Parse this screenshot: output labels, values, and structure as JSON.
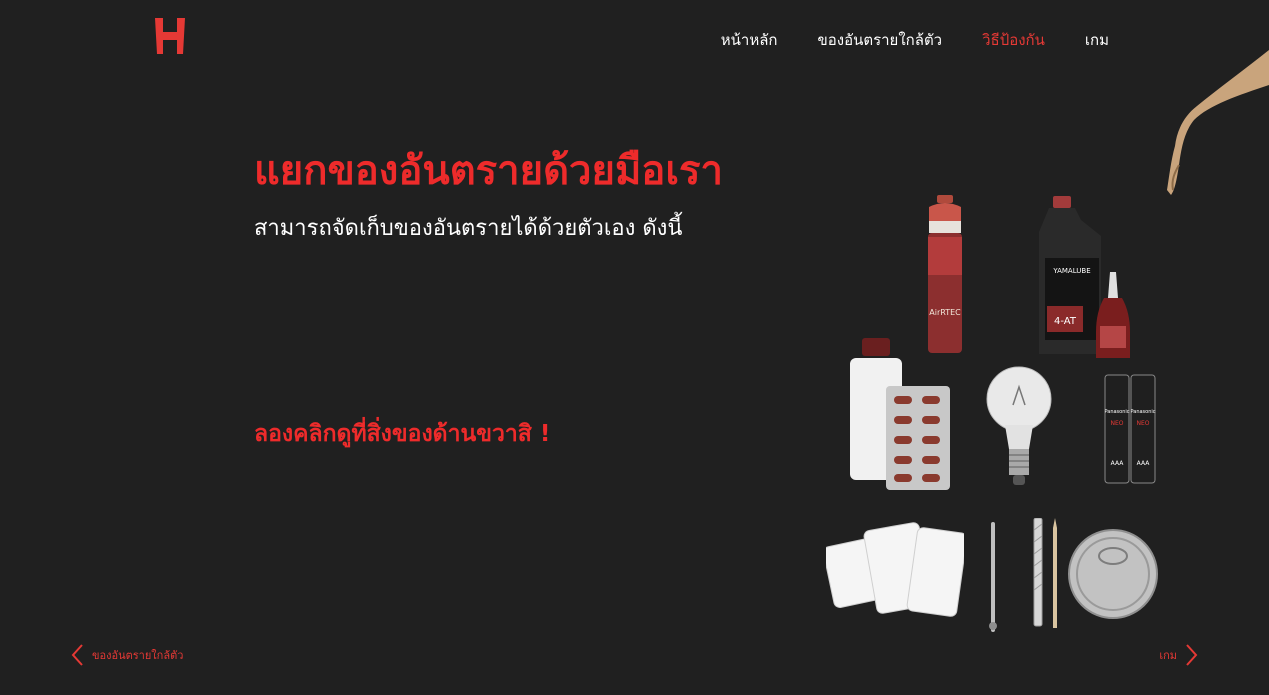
{
  "header": {
    "logo_icon": "h-logo-icon",
    "nav": [
      {
        "label": "หน้าหลัก",
        "active": false
      },
      {
        "label": "ของอันตรายใกล้ตัว",
        "active": false
      },
      {
        "label": "วิธีป้องกัน",
        "active": true
      },
      {
        "label": "เกม",
        "active": false
      }
    ]
  },
  "main": {
    "headline": "แยกของอันตรายด้วยมือเรา",
    "subheadline": "สามารถจัดเก็บของอันตรายได้ด้วยตัวเอง ดังนี้",
    "cta": "ลองคลิกดูที่สิ่งของด้านขวาสิ !"
  },
  "items": {
    "spray": {
      "label": "AirRTEC"
    },
    "oil": {
      "label": "YAMALUBE",
      "sub": "4-AT"
    },
    "batteries": {
      "brand": "Panasonic",
      "sub": "NEO",
      "size": "AAA"
    }
  },
  "pager": {
    "prev_label": "ของอันตรายใกล้ตัว",
    "next_label": "เกม"
  },
  "colors": {
    "accent": "#e53935",
    "background": "#202020"
  }
}
